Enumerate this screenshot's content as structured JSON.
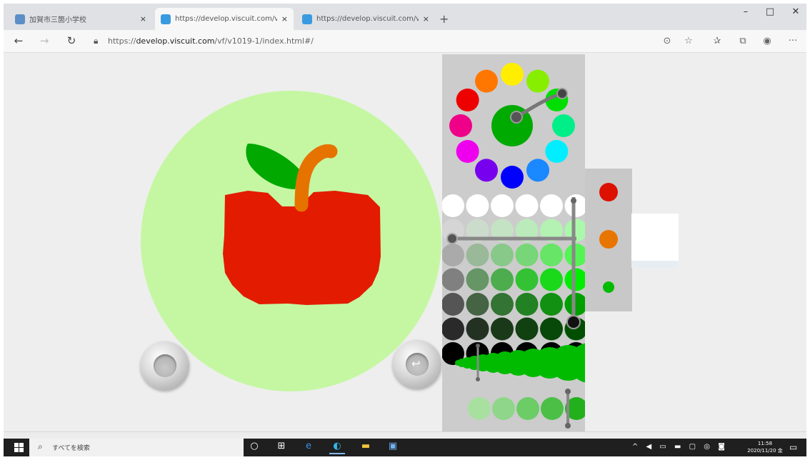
{
  "browser": {
    "tabs": [
      {
        "title": "加賀市三箇小学校",
        "close": "×"
      },
      {
        "title": "https://develop.viscuit.com/vf/",
        "close": "×"
      },
      {
        "title": "https://develop.viscuit.com/vf/",
        "close": "×"
      }
    ],
    "new_tab": "+",
    "window_controls": {
      "minimize": "–",
      "maximize": "□",
      "close": "✕"
    },
    "nav": {
      "back": "←",
      "forward": "→",
      "reload": "↻"
    },
    "address": {
      "prefix": "https://",
      "domain": "develop.viscuit.com",
      "path": "/vf/v1019-1/index.html#/"
    },
    "toolbar_icons": {
      "reading": "⊙",
      "favorite": "☆",
      "favorites_bar": "✰",
      "collections": "⧉",
      "profile": "◉",
      "more": "···"
    }
  },
  "canvas": {
    "stage_color": "#c5f7a3",
    "apple": {
      "body_color": "#e31b00",
      "leaf_color": "#00a800",
      "stem_color": "#e67300"
    }
  },
  "palette": {
    "hue_ring": [
      "#ffee00",
      "#88ee00",
      "#00dd00",
      "#00ee88",
      "#00eeff",
      "#1a88ff",
      "#0000ff",
      "#7700ee",
      "#ee00ee",
      "#ee0088",
      "#ee0000",
      "#ff7700"
    ],
    "selected_hue": "#00aa00",
    "shade_columns": 6,
    "side_swatches": [
      "#dd1100",
      "#e87500",
      "#00bb00"
    ]
  },
  "taskbar": {
    "search_placeholder": "すべてを検索",
    "clock_time": "11:58",
    "clock_date": "2020/11/20 金",
    "apps": [
      "○",
      "⊞",
      "e",
      "◐",
      "▬",
      "▣"
    ],
    "tray": "^ ◀ ▭ ▬ ▢ ◎ ◙"
  }
}
